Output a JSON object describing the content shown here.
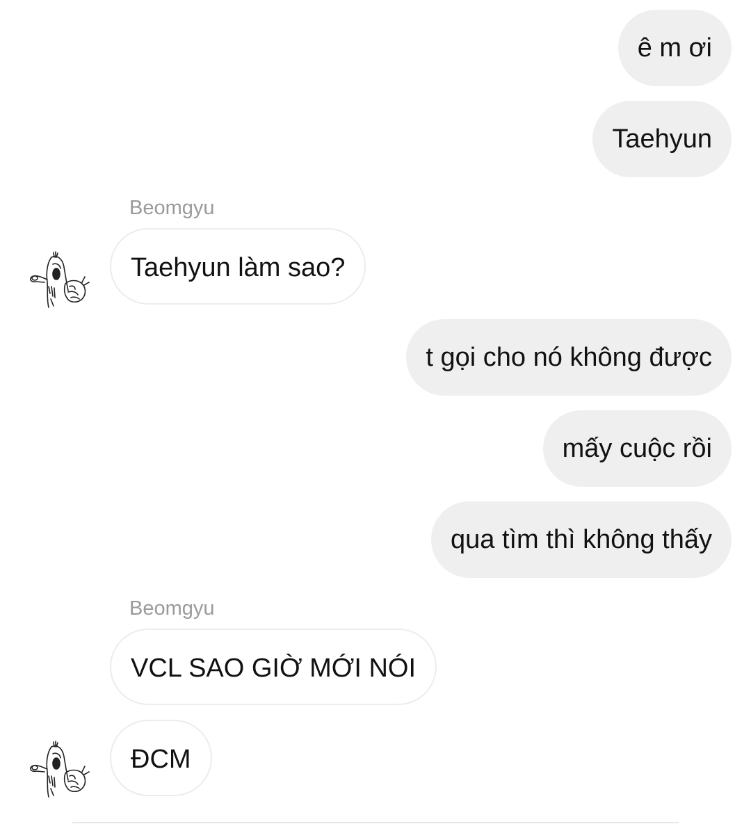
{
  "messages": [
    {
      "kind": "sent",
      "text": "ê m ơi"
    },
    {
      "kind": "sent",
      "text": "Taehyun"
    },
    {
      "kind": "received",
      "sender": "Beomgyu",
      "text": "Taehyun làm sao?"
    },
    {
      "kind": "sent",
      "text": "t gọi cho nó không được"
    },
    {
      "kind": "sent",
      "text": "mấy cuộc rồi"
    },
    {
      "kind": "sent",
      "text": "qua tìm thì không thấy"
    },
    {
      "kind": "received",
      "sender": "Beomgyu",
      "text": "VCL SAO GIỜ MỚI NÓI"
    },
    {
      "kind": "received",
      "text": "ĐCM"
    }
  ],
  "colors": {
    "sent_bubble": "#efefef",
    "received_bubble": "#ffffff",
    "received_border": "#ececec",
    "sender_name": "#9a9a9a"
  },
  "icons": {
    "avatar": "sketch-figure-avatar-icon"
  }
}
